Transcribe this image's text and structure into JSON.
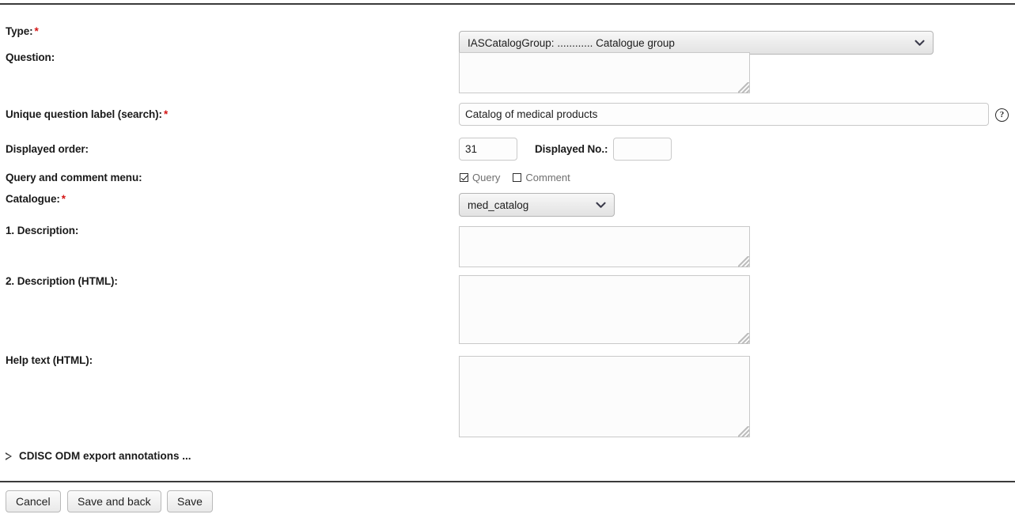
{
  "form": {
    "fields": {
      "type": {
        "label": "Type:",
        "required": "*",
        "value": "IASCatalogGroup: ............ Catalogue group",
        "chevron": "chevron-down-icon"
      },
      "question": {
        "label": "Question:",
        "value": "",
        "placeholder": ""
      },
      "unique_label": {
        "label": "Unique question label (search):",
        "required": "*",
        "value": "Catalog of medical products",
        "placeholder": "",
        "help_glyph": "?"
      },
      "displayed_order": {
        "label": "Displayed order:",
        "value": "31",
        "placeholder": ""
      },
      "displayed_no": {
        "label": "Displayed No.:",
        "value": "",
        "placeholder": ""
      },
      "query_comment_menu": {
        "label": "Query and comment menu:",
        "options": [
          {
            "label": "Query",
            "checked": true
          },
          {
            "label": "Comment",
            "checked": false
          }
        ]
      },
      "catalogue": {
        "label": "Catalogue:",
        "required": "*",
        "value": "med_catalog",
        "chevron": "chevron-down-icon"
      },
      "description_1": {
        "label": "1. Description:",
        "value": "",
        "placeholder": ""
      },
      "description_2": {
        "label": "2. Description (HTML):",
        "value": "",
        "placeholder": ""
      },
      "help_text": {
        "label": "Help text (HTML):",
        "value": "",
        "placeholder": ""
      }
    },
    "disclosure": {
      "label": "CDISC ODM export annotations ..."
    },
    "buttons": {
      "cancel": "Cancel",
      "save_and_back": "Save and back",
      "save": "Save"
    }
  },
  "colors": {
    "required_marker": "#d41616",
    "label_text": "#1a1a1a",
    "rule": "#3b3b3b",
    "checkbox_label": "#6f6f6f"
  }
}
